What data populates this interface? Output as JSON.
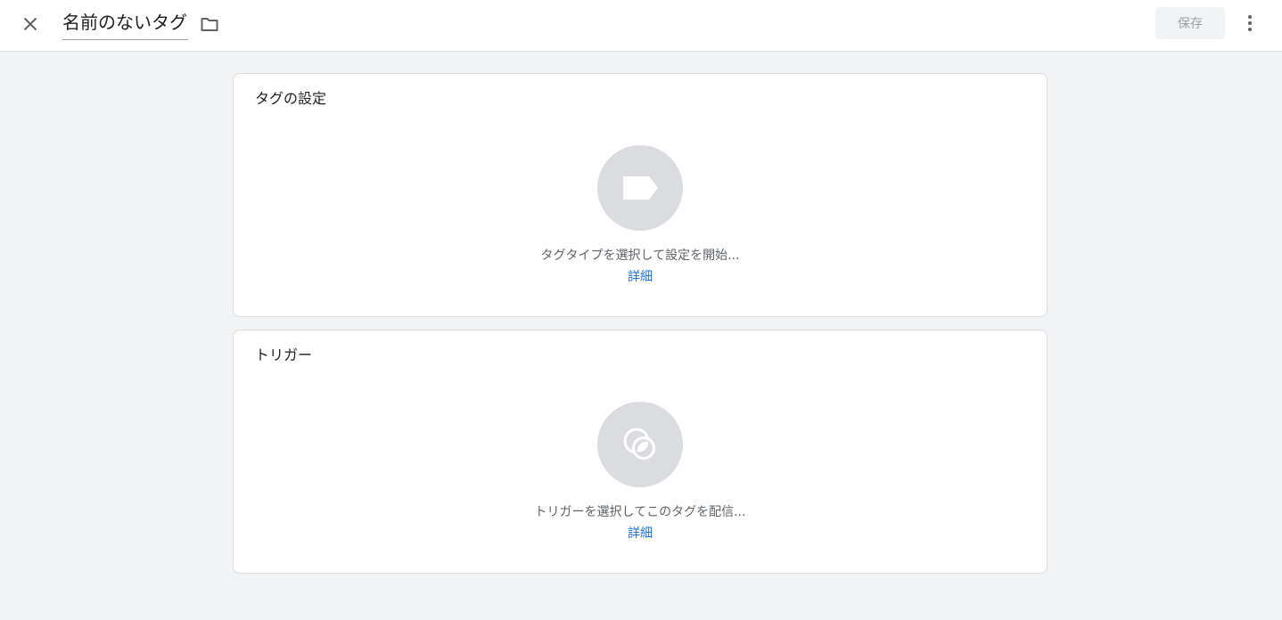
{
  "header": {
    "tag_name": "名前のないタグ",
    "save_label": "保存"
  },
  "tag_config": {
    "title": "タグの設定",
    "description": "タグタイプを選択して設定を開始...",
    "link": "詳細",
    "icon": "tag-icon"
  },
  "trigger": {
    "title": "トリガー",
    "description": "トリガーを選択してこのタグを配信...",
    "link": "詳細",
    "icon": "trigger-icon"
  },
  "colors": {
    "accent": "#1a73e8",
    "background": "#f1f3f4",
    "icon_circle": "#dadce0"
  }
}
